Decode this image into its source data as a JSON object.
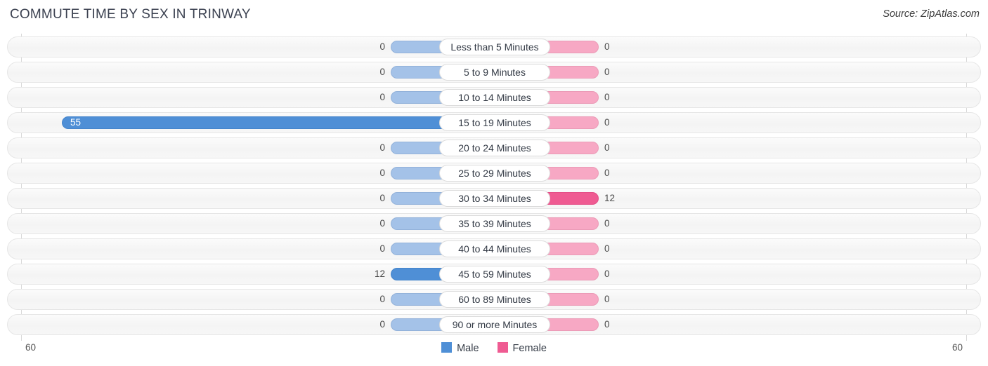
{
  "header": {
    "title": "COMMUTE TIME BY SEX IN TRINWAY",
    "source": "Source: ZipAtlas.com"
  },
  "axis": {
    "left_tick": "60",
    "right_tick": "60"
  },
  "legend": {
    "items": [
      {
        "label": "Male",
        "color": "#4f8fd6"
      },
      {
        "label": "Female",
        "color": "#ef5b92"
      }
    ]
  },
  "chart_data": {
    "type": "bar",
    "title": "COMMUTE TIME BY SEX IN TRINWAY",
    "subtitle": "Source: ZipAtlas.com",
    "orientation": "horizontal-diverging",
    "xlabel": "",
    "ylabel": "",
    "xlim": [
      60,
      60
    ],
    "axis_max_left": 60,
    "axis_max_right": 60,
    "grid": false,
    "legend_position": "bottom-center",
    "categories": [
      "Less than 5 Minutes",
      "5 to 9 Minutes",
      "10 to 14 Minutes",
      "15 to 19 Minutes",
      "20 to 24 Minutes",
      "25 to 29 Minutes",
      "30 to 34 Minutes",
      "35 to 39 Minutes",
      "40 to 44 Minutes",
      "45 to 59 Minutes",
      "60 to 89 Minutes",
      "90 or more Minutes"
    ],
    "series": [
      {
        "name": "Male",
        "color": "#4f8fd6",
        "zero_color": "#a4c2e8",
        "values": [
          0,
          0,
          0,
          55,
          0,
          0,
          0,
          0,
          0,
          12,
          0,
          0
        ]
      },
      {
        "name": "Female",
        "color": "#ef5b92",
        "zero_color": "#f7a8c4",
        "values": [
          0,
          0,
          0,
          0,
          0,
          0,
          12,
          0,
          0,
          0,
          0,
          0
        ]
      }
    ]
  },
  "rows": [
    {
      "label": "Less than 5 Minutes",
      "male": "0",
      "female": "0"
    },
    {
      "label": "5 to 9 Minutes",
      "male": "0",
      "female": "0"
    },
    {
      "label": "10 to 14 Minutes",
      "male": "0",
      "female": "0"
    },
    {
      "label": "15 to 19 Minutes",
      "male": "55",
      "female": "0"
    },
    {
      "label": "20 to 24 Minutes",
      "male": "0",
      "female": "0"
    },
    {
      "label": "25 to 29 Minutes",
      "male": "0",
      "female": "0"
    },
    {
      "label": "30 to 34 Minutes",
      "male": "0",
      "female": "12"
    },
    {
      "label": "35 to 39 Minutes",
      "male": "0",
      "female": "0"
    },
    {
      "label": "40 to 44 Minutes",
      "male": "0",
      "female": "0"
    },
    {
      "label": "45 to 59 Minutes",
      "male": "12",
      "female": "0"
    },
    {
      "label": "60 to 89 Minutes",
      "male": "0",
      "female": "0"
    },
    {
      "label": "90 or more Minutes",
      "male": "0",
      "female": "0"
    }
  ]
}
